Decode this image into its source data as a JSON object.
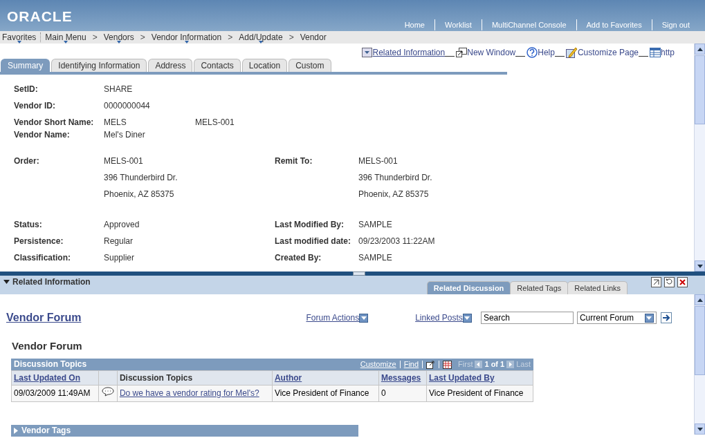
{
  "header": {
    "logo": "ORACLE",
    "links": [
      "Home",
      "Worklist",
      "MultiChannel Console",
      "Add to Favorites",
      "Sign out"
    ]
  },
  "breadcrumbs": [
    {
      "label": "Favorites",
      "menu": true
    },
    {
      "label": "Main Menu",
      "menu": true
    },
    {
      "label": "Vendors",
      "menu": true,
      "sep": ">"
    },
    {
      "label": "Vendor Information",
      "menu": true,
      "sep": ">"
    },
    {
      "label": "Add/Update",
      "menu": true,
      "sep": ">"
    },
    {
      "label": "Vendor",
      "menu": false,
      "sep": ">"
    }
  ],
  "page_links": [
    {
      "label": "Related Information",
      "underlined": true
    },
    {
      "label": "New Window",
      "underlined": false
    },
    {
      "label": "Help",
      "underlined": false
    },
    {
      "label": "Customize Page",
      "underlined": false
    },
    {
      "label": "http",
      "underlined": false
    }
  ],
  "tabs": [
    {
      "label": "Summary",
      "selected": true
    },
    {
      "label": "Identifying Information",
      "selected": false
    },
    {
      "label": "Address",
      "selected": false
    },
    {
      "label": "Contacts",
      "selected": false
    },
    {
      "label": "Location",
      "selected": false
    },
    {
      "label": "Custom",
      "selected": false
    }
  ],
  "ids": [
    {
      "label": "SetID:",
      "value": "SHARE"
    },
    {
      "label": "Vendor ID:",
      "value": "0000000044"
    },
    {
      "label": "Vendor Short Name:",
      "value": "MELS",
      "extra": "MELS-001"
    },
    {
      "label": "Vendor Name:",
      "value": "Mel's Diner"
    }
  ],
  "addresses": [
    {
      "label": "Order:",
      "lines": [
        "MELS-001",
        "396 Thunderbird Dr.",
        "Phoenix, AZ  85375"
      ]
    },
    {
      "label": "Remit To:",
      "lines": [
        "MELS-001",
        "396 Thunderbird Dr.",
        "Phoenix, AZ  85375"
      ]
    }
  ],
  "status_fields": [
    [
      {
        "label": "Status:",
        "value": "Approved"
      },
      {
        "label": "Last Modified By:",
        "value": "SAMPLE"
      }
    ],
    [
      {
        "label": "Persistence:",
        "value": "Regular"
      },
      {
        "label": "Last modified date:",
        "value": "09/23/2003 11:22AM"
      }
    ],
    [
      {
        "label": "Classification:",
        "value": "Supplier"
      },
      {
        "label": "Created By:",
        "value": "SAMPLE"
      }
    ]
  ],
  "related": {
    "title": "Related Information",
    "tabs": [
      {
        "label": "Related Discussion",
        "selected": true
      },
      {
        "label": "Related Tags",
        "selected": false
      },
      {
        "label": "Related Links",
        "selected": false
      }
    ]
  },
  "forum": {
    "title": "Vendor Forum",
    "actions": "Forum Actions",
    "linked": "Linked Posts",
    "search": "Search",
    "scope": "Current Forum",
    "heading": "Vendor Forum",
    "grid": {
      "title": "Discussion Topics",
      "tools": [
        "Customize",
        "Find"
      ],
      "first": "First",
      "count": "1 of 1",
      "last": "Last",
      "columns": [
        {
          "label": "Last Updated On",
          "link": true
        },
        {},
        {
          "label": "Discussion Topics",
          "link": false
        },
        {
          "label": "Author",
          "link": true
        },
        {
          "label": "Messages",
          "link": true
        },
        {
          "label": "Last Updated By",
          "link": true
        }
      ],
      "rows": [
        [
          "09/03/2009 11:49AM",
          "",
          "Do we have a vendor rating for Mel's?",
          "Vice President of Finance",
          "0",
          "Vice President of Finance"
        ]
      ]
    },
    "collapsed": "Vendor Tags"
  }
}
